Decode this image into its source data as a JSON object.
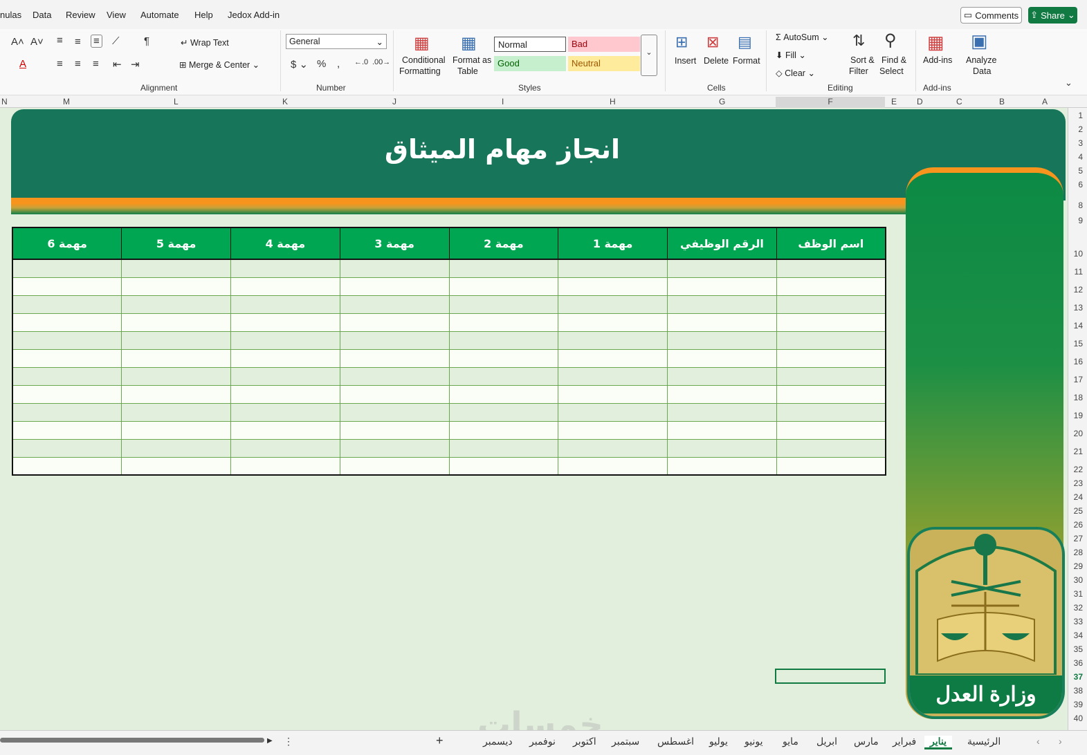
{
  "menu": [
    "nulas",
    "Data",
    "Review",
    "View",
    "Automate",
    "Help",
    "Jedox Add-in"
  ],
  "comments_label": "Comments",
  "share_label": "Share",
  "ribbon": {
    "wrap_text": "Wrap Text",
    "merge_center": "Merge & Center",
    "alignment": "Alignment",
    "number_format": "General",
    "number": "Number",
    "cond_fmt_1": "Conditional",
    "cond_fmt_2": "Formatting",
    "fmt_table_1": "Format as",
    "fmt_table_2": "Table",
    "styles": "Styles",
    "style_normal": "Normal",
    "style_bad": "Bad",
    "style_good": "Good",
    "style_neutral": "Neutral",
    "insert": "Insert",
    "delete": "Delete",
    "format": "Format",
    "cells": "Cells",
    "autosum": "AutoSum",
    "fill": "Fill",
    "clear": "Clear",
    "sort_1": "Sort &",
    "sort_2": "Filter",
    "find_1": "Find &",
    "find_2": "Select",
    "editing": "Editing",
    "addins": "Add-ins",
    "addins_group": "Add-ins",
    "analyze_1": "Analyze",
    "analyze_2": "Data"
  },
  "columns": [
    "N",
    "M",
    "L",
    "K",
    "J",
    "I",
    "H",
    "G",
    "F",
    "E",
    "D",
    "C",
    "B",
    "A"
  ],
  "rows": [
    "1",
    "2",
    "3",
    "4",
    "5",
    "6",
    "8",
    "9",
    "10",
    "11",
    "12",
    "13",
    "14",
    "15",
    "16",
    "17",
    "18",
    "19",
    "20",
    "21",
    "22",
    "23",
    "24",
    "25",
    "26",
    "27",
    "28",
    "29",
    "30",
    "31",
    "32",
    "33",
    "34",
    "35",
    "36",
    "37",
    "38",
    "39",
    "40"
  ],
  "sheet": {
    "title": "انجاز مهام الميثاق",
    "headers": [
      "مهمة 6",
      "مهمة 5",
      "مهمة 4",
      "مهمة 3",
      "مهمة 2",
      "مهمة 1",
      "الرقم الوظيفي",
      "اسم الوظف"
    ],
    "emblem_caption": "وزارة العدل"
  },
  "tabs": [
    "ديسمبر",
    "نوفمبر",
    "اكتوبر",
    "سبتمبر",
    "اغسطس",
    "يوليو",
    "يونيو",
    "مايو",
    "ابريل",
    "مارس",
    "فبراير",
    "يناير",
    "الرئيسية"
  ],
  "active_tab": "يناير",
  "watermark": "خمسات",
  "colors": {
    "accent": "#117a43",
    "banner": "#17765a",
    "header": "#00a651",
    "stripe": "#f7941d",
    "sheet_bg": "#e2efdc"
  }
}
